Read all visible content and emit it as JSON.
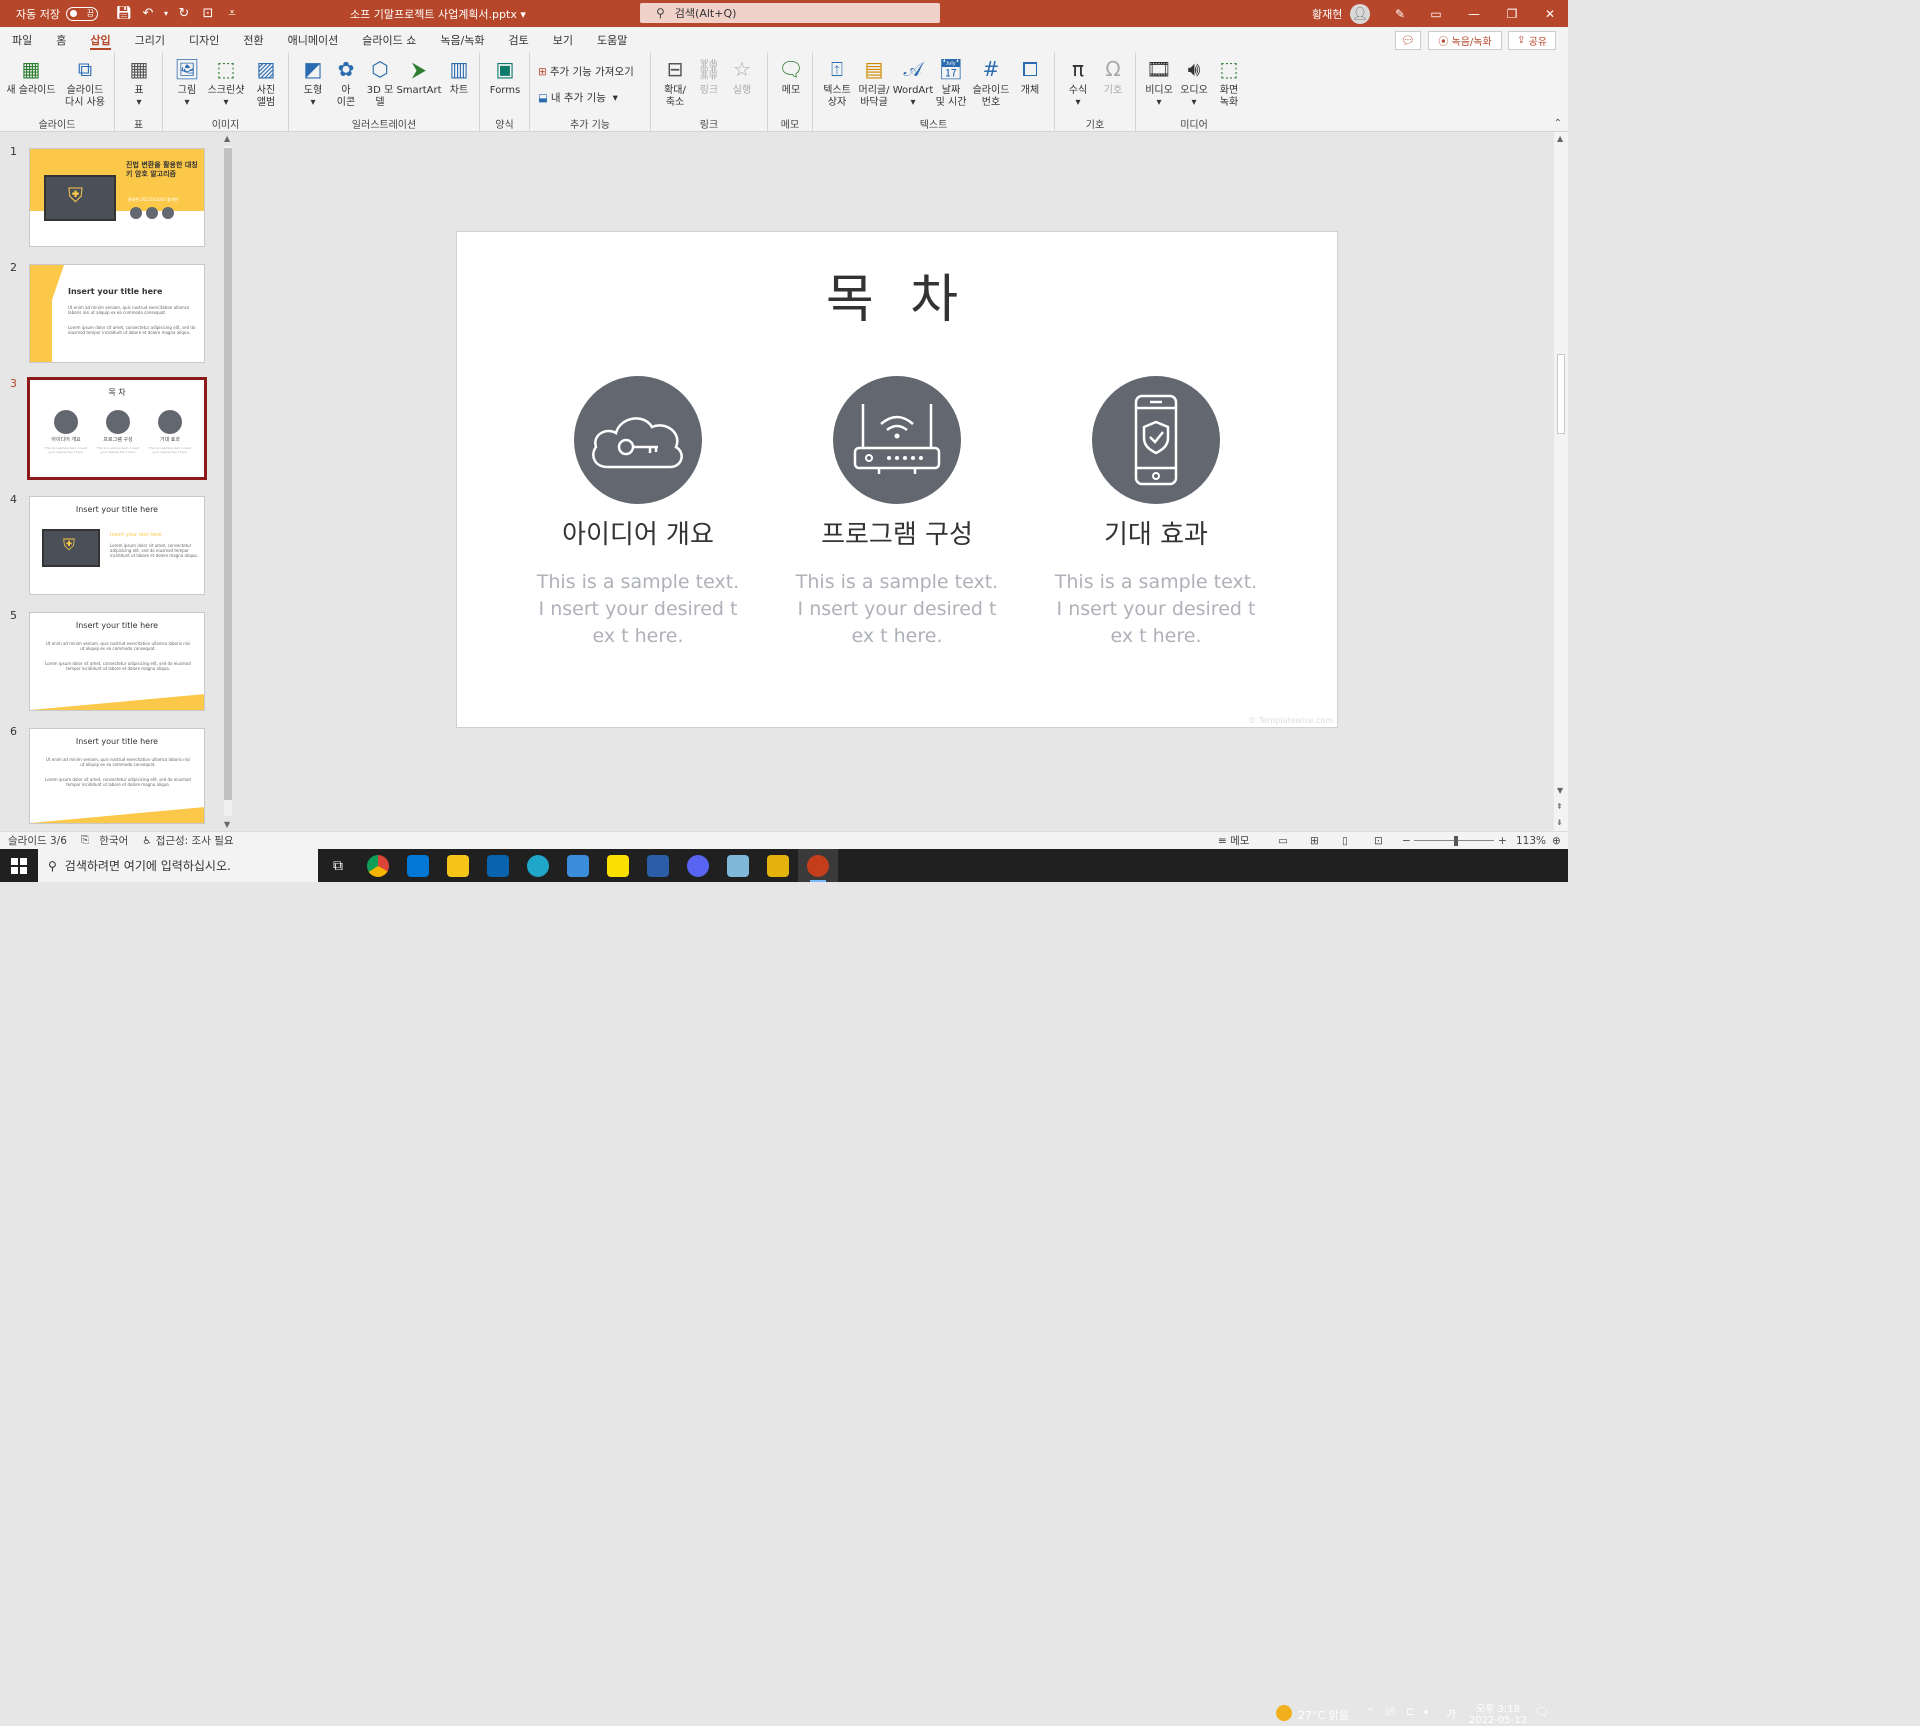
{
  "titlebar": {
    "autosave_label": "자동 저장",
    "autosave_state": "끔",
    "document_title": "소프 기말프로젝트 사업계획서.pptx",
    "search_placeholder": "검색(Alt+Q)",
    "user_name": "황재현"
  },
  "menu": {
    "tabs": [
      "파일",
      "홈",
      "삽입",
      "그리기",
      "디자인",
      "전환",
      "애니메이션",
      "슬라이드 쇼",
      "녹음/녹화",
      "검토",
      "보기",
      "도움말"
    ],
    "active_tab": "삽입",
    "record_label": "녹음/녹화",
    "share_label": "공유"
  },
  "ribbon": {
    "groups": {
      "slides": "슬라이드",
      "table": "표",
      "images": "이미지",
      "illustrations": "일러스트레이션",
      "forms": "양식",
      "addins": "추가 기능",
      "links": "링크",
      "comments": "메모",
      "text": "텍스트",
      "symbols": "기호",
      "media": "미디어"
    },
    "buttons": {
      "new_slide": "새 슬라이드",
      "reuse_slide": "슬라이드\n다시 사용",
      "table": "표",
      "pictures": "그림",
      "screenshot": "스크린샷",
      "photo_album": "사진\n앨범",
      "shapes": "도형",
      "icons": "아\n이콘",
      "3d_models": "3D 모\n델",
      "smartart": "SmartArt",
      "chart": "차트",
      "forms": "Forms",
      "get_addins": "추가 기능 가져오기",
      "my_addins": "내 추가 기능",
      "zoom": "확대/\n축소",
      "link": "링크",
      "action": "실행",
      "comment": "메모",
      "textbox": "텍스트\n상자",
      "header_footer": "머리글/\n바닥글",
      "wordart": "WordArt",
      "date_time": "날짜\n및 시간",
      "slide_number": "슬라이드\n번호",
      "object": "개체",
      "equation": "수식",
      "symbol": "기호",
      "video": "비디오",
      "audio": "오디오",
      "screen_recording": "화면\n녹화"
    }
  },
  "thumbnails": [
    {
      "num": "1",
      "title": "진법 변환을 활용한 대칭키 암호 알고리즘",
      "subtitle": "환재현 2021161024 황재현"
    },
    {
      "num": "2",
      "title": "Insert your title here",
      "body1": "Ut enim ad minim veniam, quis nostrud exercitation ullamco laboris nisi ut aliquip ex ea commodo consequat.",
      "body2": "Lorem ipsum dolor sit amet, consectetur adipisicing elit, sed do eiusmod tempor incididunt ut labore et dolore magna aliqua."
    },
    {
      "num": "3",
      "title": "목 차",
      "labels": [
        "아이디어 개요",
        "프로그램 구성",
        "기대 효과"
      ],
      "small": "This is a sample text. I nsert your desired tex t here."
    },
    {
      "num": "4",
      "title": "Insert your title here",
      "accent": "Insert your text here",
      "body": "Lorem ipsum dolor sit amet, consectetur adipisicing elit, sed do eiusmod tempor incididunt ut labore et dolore magna aliqua."
    },
    {
      "num": "5",
      "title": "Insert your title here",
      "body1": "Ut enim ad minim veniam, quis nostrud exercitation ullamco laboris nisi ut aliquip ex ea commodo consequat.",
      "body2": "Lorem ipsum dolor sit amet, consectetur adipisicing elit, sed do eiusmod tempor incididunt ut labore et dolore magna aliqua."
    },
    {
      "num": "6",
      "title": "Insert your title here",
      "body1": "Ut enim ad minim veniam, quis nostrud exercitation ullamco laboris nisi ut aliquip ex ea commodo consequat.",
      "body2": "Lorem ipsum dolor sit amet, consectetur adipisicing elit, sed do eiusmod tempor incididunt ut labore et dolore magna aliqua."
    }
  ],
  "slide": {
    "title": "목 차",
    "items": [
      {
        "title": "아이디어 개요",
        "body": "This is a sample text. I nsert your desired tex t here.",
        "icon": "cloud-key-icon"
      },
      {
        "title": "프로그램 구성",
        "body": "This is a sample text. I nsert your desired tex t here.",
        "icon": "router-icon"
      },
      {
        "title": "기대 효과",
        "body": "This is a sample text. I nsert your desired tex t here.",
        "icon": "phone-shield-icon"
      }
    ],
    "copyright": "© Templatewise.com"
  },
  "statusbar": {
    "slide_pos": "슬라이드 3/6",
    "language": "한국어",
    "accessibility": "접근성: 조사 필요",
    "notes": "메모",
    "zoom": "113%"
  },
  "taskbar": {
    "search_placeholder": "검색하려면 여기에 입력하십시오.",
    "weather": "27°C 맑음",
    "ime": "가",
    "time": "오후 3:18",
    "date": "2022-05-12"
  },
  "colors": {
    "accent": "#b7472a",
    "slide_icon_bg": "#626770",
    "yellow": "#fcc84a",
    "selected_border": "#8b1a1a"
  }
}
